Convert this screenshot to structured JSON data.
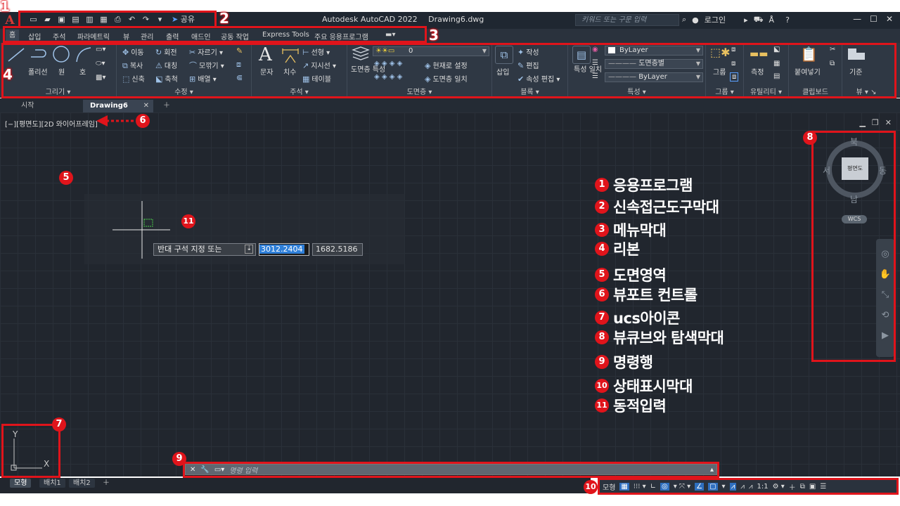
{
  "app": {
    "title_app": "Autodesk AutoCAD 2022",
    "title_file": "Drawing6.dwg",
    "logo_letter": "A",
    "share_label": "공유",
    "search_placeholder": "키워드 또는 구문 입력",
    "login_label": "로그인",
    "help_label": "?"
  },
  "menu_tabs": [
    "홈",
    "삽입",
    "주석",
    "파라메트릭",
    "뷰",
    "관리",
    "출력",
    "애드인",
    "공동 작업",
    "Express Tools",
    "주요 응용프로그램"
  ],
  "ribbon": {
    "draw": {
      "title": "그리기",
      "line": "선",
      "polyline": "폴리선",
      "circle": "원",
      "arc": "호"
    },
    "modify": {
      "title": "수정",
      "move": "이동",
      "rotate": "회전",
      "trim": "자르기",
      "copy": "복사",
      "mirror": "대칭",
      "fillet": "모깎기",
      "stretch": "신축",
      "scale": "축척",
      "array": "배열"
    },
    "annotation": {
      "title": "주석",
      "text": "문자",
      "dimension": "치수",
      "linear": "선형",
      "leader": "지시선",
      "table": "테이블"
    },
    "layers": {
      "title": "도면층",
      "layer_props": "도면층 특성",
      "layer_value": "0",
      "make_current": "현재로 설정",
      "match_layer": "도면층 일치"
    },
    "block": {
      "title": "블록",
      "insert": "삽입",
      "create": "작성",
      "edit": "편집",
      "edit_attr": "속성 편집"
    },
    "properties": {
      "title": "특성",
      "match": "특성 일치",
      "color": "ByLayer",
      "linetype": "도면층별",
      "lineweight": "ByLayer"
    },
    "groups": {
      "title": "그룹",
      "group": "그룹"
    },
    "utilities": {
      "title": "유틸리티",
      "measure": "측정"
    },
    "clipboard": {
      "title": "클립보드",
      "paste": "붙여넣기"
    },
    "view": {
      "title": "뷰",
      "base": "기준"
    }
  },
  "doc_tabs": {
    "start": "시작",
    "active": "Drawing6"
  },
  "viewport_control": "[−][평면도][2D 와이어프레임]",
  "dynamic_input": {
    "prompt": "반대 구석 지정 또는",
    "value1": "3012.2404",
    "value2": "1682.5186"
  },
  "viewcube": {
    "north": "북",
    "south": "남",
    "east": "동",
    "west": "서",
    "face": "평면도",
    "wcs": "WCS"
  },
  "ucs": {
    "x": "X",
    "y": "Y"
  },
  "command_line": {
    "placeholder": "명령 입력"
  },
  "layout_tabs": [
    "모형",
    "배치1",
    "배치2"
  ],
  "status_bar": {
    "model_label": "모형",
    "scale": "1:1"
  },
  "annotations": [
    {
      "num": "1",
      "label": "응용프로그램"
    },
    {
      "num": "2",
      "label": "신속접근도구막대"
    },
    {
      "num": "3",
      "label": "메뉴막대"
    },
    {
      "num": "4",
      "label": "리본"
    },
    {
      "num": "5",
      "label": "도면영역"
    },
    {
      "num": "6",
      "label": "뷰포트 컨트롤"
    },
    {
      "num": "7",
      "label": "ucs아이콘"
    },
    {
      "num": "8",
      "label": "뷰큐브와 탐색막대"
    },
    {
      "num": "9",
      "label": "명령행"
    },
    {
      "num": "10",
      "label": "상태표시막대"
    },
    {
      "num": "11",
      "label": "동적입력"
    }
  ],
  "colors": {
    "annotation_red": "#e0141b",
    "canvas_bg": "#21262e",
    "ribbon_bg": "#2f3844"
  }
}
